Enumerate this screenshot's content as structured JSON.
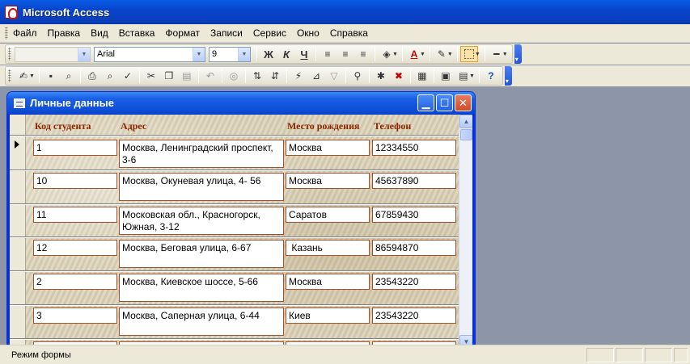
{
  "app": {
    "title": "Microsoft Access"
  },
  "menu": [
    "Файл",
    "Правка",
    "Вид",
    "Вставка",
    "Формат",
    "Записи",
    "Сервис",
    "Окно",
    "Справка"
  ],
  "format_toolbar": {
    "object": "",
    "font": "Arial",
    "size": "9",
    "bold": "Ж",
    "italic": "К",
    "underline": "Ч"
  },
  "form": {
    "title": "Личные данные",
    "headers": {
      "code": "Код студента",
      "address": "Адрес",
      "birthplace": "Место рождения",
      "phone": "Телефон"
    },
    "records": [
      {
        "code": "1",
        "address": "Москва, Ленинградский проспект, 3-6",
        "birthplace": "Москва",
        "phone": "12334550"
      },
      {
        "code": "10",
        "address": "Москва, Окуневая улица, 4- 56",
        "birthplace": "Москва",
        "phone": "45637890"
      },
      {
        "code": "11",
        "address": "Московская обл., Красногорск, Южная, 3-12",
        "birthplace": "Саратов",
        "phone": "67859430"
      },
      {
        "code": "12",
        "address": "Москва, Беговая улица, 6-67",
        "birthplace": " Казань",
        "phone": "86594870"
      },
      {
        "code": "2",
        "address": "Москва, Киевское шоссе, 5-66",
        "birthplace": "Москва",
        "phone": "23543220"
      },
      {
        "code": "3",
        "address": "Москва, Саперная улица, 6-44",
        "birthplace": "Киев",
        "phone": "23543220"
      }
    ]
  },
  "status": {
    "text": "Режим формы"
  },
  "colors": {
    "title_bar": "#0843c9",
    "field_border": "#a0522d",
    "header_text": "#8b2500",
    "workspace": "#8c96a8"
  }
}
